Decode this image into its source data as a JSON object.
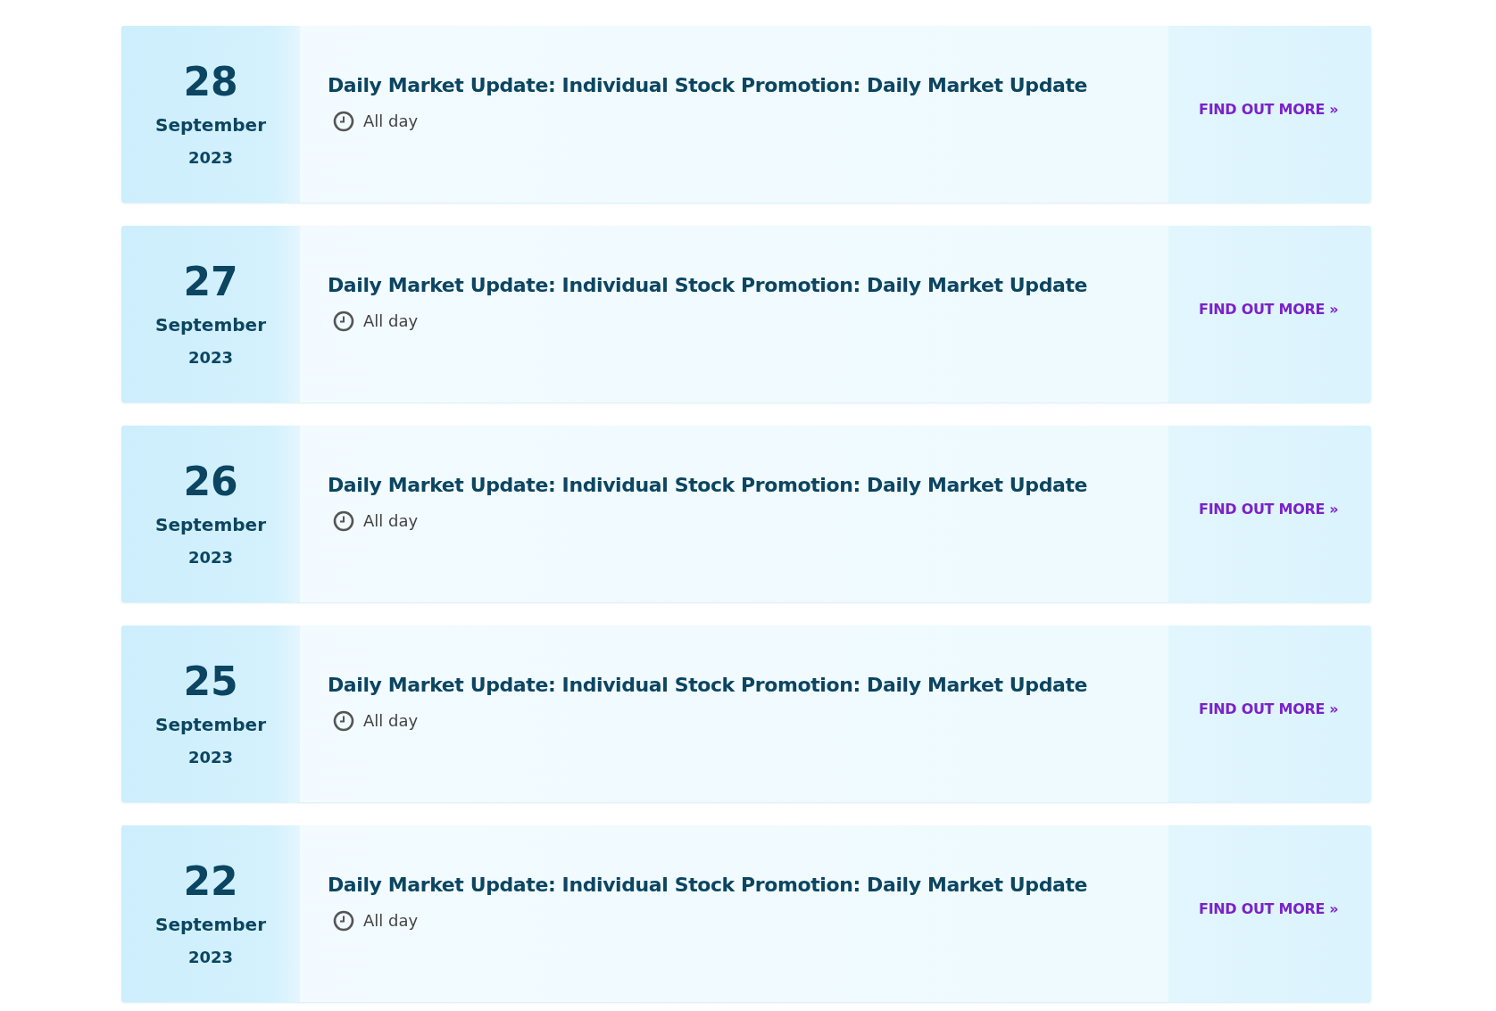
{
  "events": [
    {
      "day": "28",
      "month": "September",
      "year": "2023",
      "title": "Daily Market Update: Individual Stock Promotion: Daily Market Update",
      "time": "All day",
      "link": "FIND OUT MORE »"
    },
    {
      "day": "27",
      "month": "September",
      "year": "2023",
      "title": "Daily Market Update: Individual Stock Promotion: Daily Market Update",
      "time": "All day",
      "link": "FIND OUT MORE »"
    },
    {
      "day": "26",
      "month": "September",
      "year": "2023",
      "title": "Daily Market Update: Individual Stock Promotion: Daily Market Update",
      "time": "All day",
      "link": "FIND OUT MORE »"
    },
    {
      "day": "25",
      "month": "September",
      "year": "2023",
      "title": "Daily Market Update: Individual Stock Promotion: Daily Market Update",
      "time": "All day",
      "link": "FIND OUT MORE »"
    },
    {
      "day": "22",
      "month": "September",
      "year": "2023",
      "title": "Daily Market Update: Individual Stock Promotion: Daily Market Update",
      "time": "All day",
      "link": "FIND OUT MORE »"
    }
  ]
}
